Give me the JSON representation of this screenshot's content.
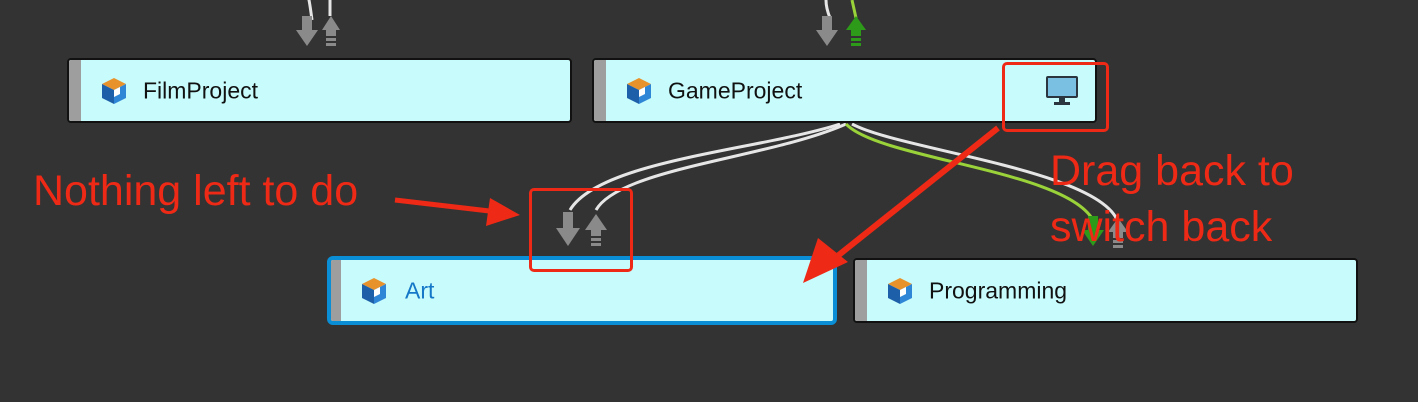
{
  "colors": {
    "background": "#333333",
    "node_fill": "#c8fcfc",
    "node_border": "#111111",
    "selected_border": "#0a8fd6",
    "selected_label": "#1577c7",
    "annotation_red": "#ee2a16",
    "wire_white": "#e6e6e6",
    "wire_green": "#9ad23a",
    "port_gray": "#8a8a8a",
    "port_green": "#2e9a1a"
  },
  "icons": {
    "stream": "stream-cube-icon",
    "workspace": "monitor-icon",
    "fetch": "arrow-down-icon",
    "submit": "arrow-up-icon"
  },
  "nodes": {
    "film_project": {
      "label": "FilmProject",
      "selected": false
    },
    "game_project": {
      "label": "GameProject",
      "selected": false,
      "has_workspace": true
    },
    "art": {
      "label": "Art",
      "selected": true
    },
    "programming": {
      "label": "Programming",
      "selected": false
    }
  },
  "annotations": {
    "nothing_left": "Nothing left to do",
    "drag_back_line1": "Drag back to",
    "drag_back_line2": "switch back"
  }
}
